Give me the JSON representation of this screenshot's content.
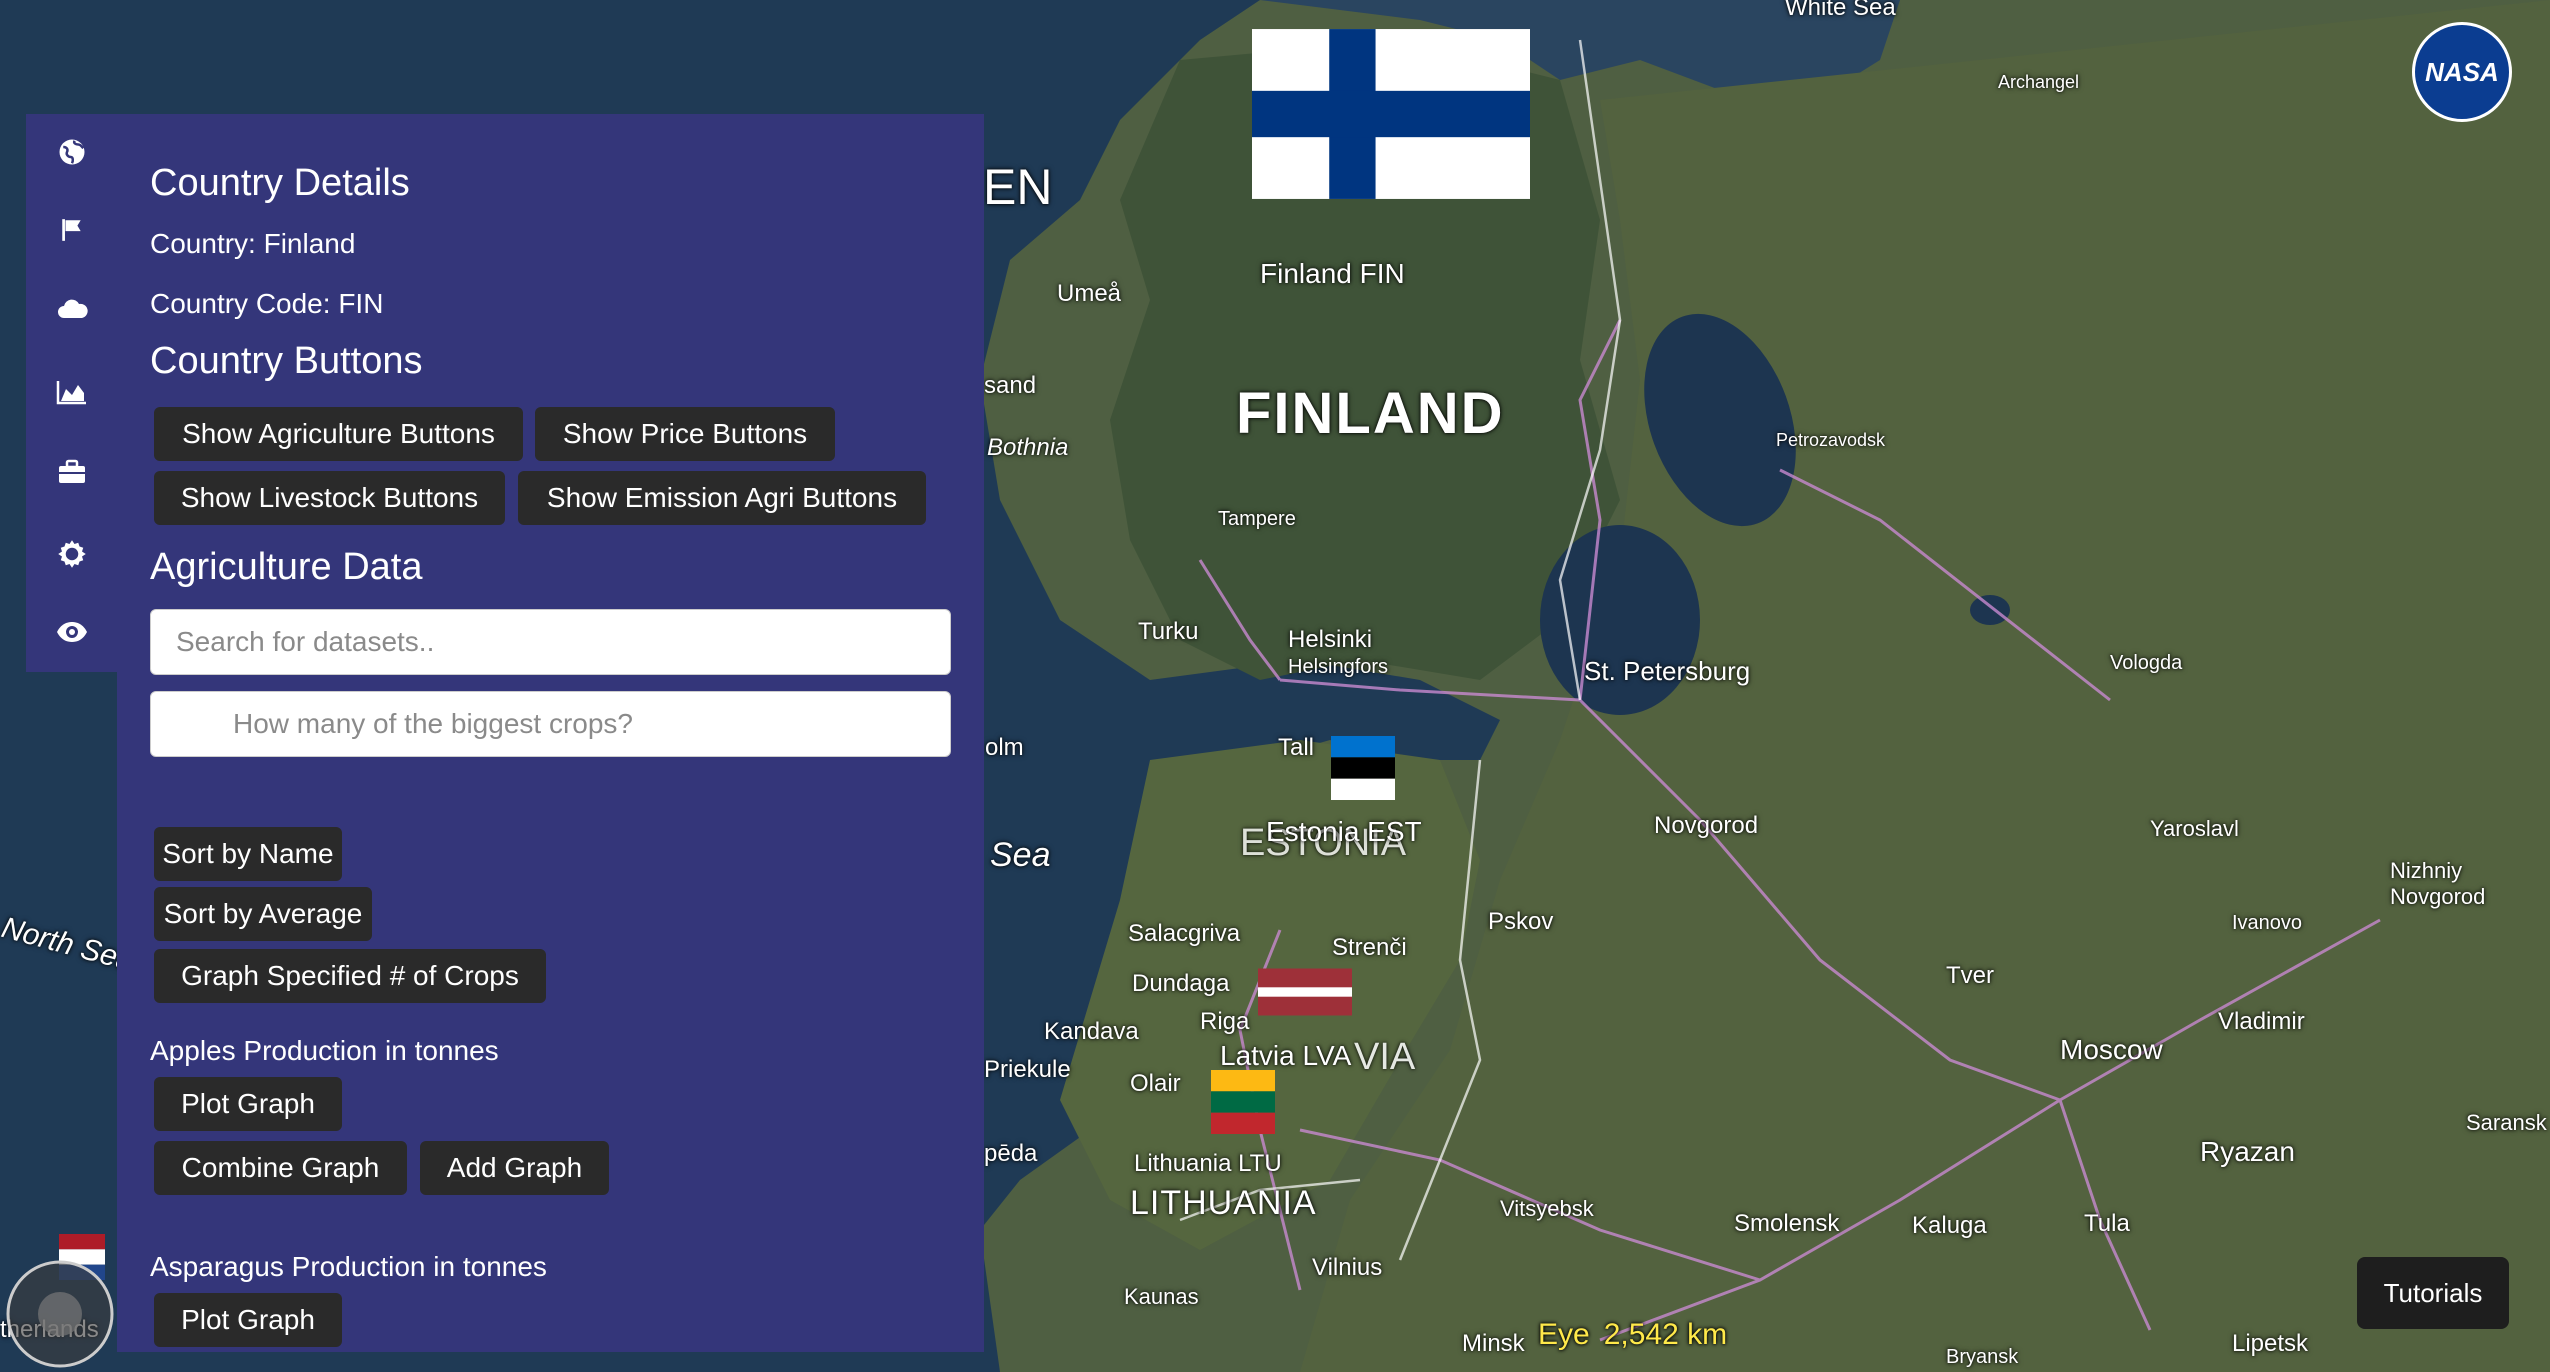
{
  "map": {
    "labels": {
      "finland_big": "FINLAND",
      "finland_flag_label": "Finland FIN",
      "estonia_flag_label": "Estonia EST",
      "latvia_flag_label": "Latvia LVA",
      "lithuania_flag_label": "Lithuania LTU",
      "lithuania_big": "LITHUANIA",
      "estonia_big": "ESTONIA",
      "latvia_big": "VIA",
      "white_sea": "White Sea",
      "north_sea": "North Sea",
      "sea": "Sea",
      "bothnia": "Bothnia",
      "en": "EN",
      "umea": "Umeå",
      "sand": "sand",
      "olm": "olm",
      "tampere": "Tampere",
      "turku": "Turku",
      "helsinki": "Helsinki",
      "helsingfors": "Helsingfors",
      "tallinn": "Tall",
      "st_petersburg": "St. Petersburg",
      "petrozavodsk": "Petrozavodsk",
      "vologda": "Vologda",
      "archangel": "Archangel",
      "novgorod": "Novgorod",
      "yaroslavl": "Yaroslavl",
      "ivanovo": "Ivanovo",
      "nizhniy": "Nizhniy Novgorod",
      "pskov": "Pskov",
      "tver": "Tver",
      "moscow": "Moscow",
      "vladimir": "Vladimir",
      "ryazan": "Ryazan",
      "saransk": "Saransk",
      "tula": "Tula",
      "kaluga": "Kaluga",
      "smolensk": "Smolensk",
      "vitsyebsk": "Vitsyebsk",
      "vilnius": "Vilnius",
      "kaunas": "Kaunas",
      "minsk": "Minsk",
      "salacgriva": "Salacgriva",
      "strenci": "Strenči",
      "dundaga": "Dundaga",
      "riga": "Riga",
      "kandava": "Kandava",
      "priekule": "Priekule",
      "olaine": "Olair",
      "lipetsk": "Lipetsk",
      "bryansk": "Bryansk",
      "peda": "pēda",
      "netherlands": "therlands"
    },
    "eye_label": "Eye",
    "eye_value": "2,542 km",
    "nasa_logo_text": "NASA",
    "tutorials_label": "Tutorials"
  },
  "sidebar": {
    "icons": [
      "globe-icon",
      "flag-icon",
      "cloud-icon",
      "area-chart-icon",
      "briefcase-icon",
      "gear-icon",
      "eye-icon"
    ]
  },
  "panel": {
    "country_details_title": "Country Details",
    "country_line": "Country: Finland",
    "country_code_line": "Country Code: FIN",
    "country_buttons_title": "Country Buttons",
    "buttons": {
      "agriculture": "Show Agriculture Buttons",
      "price": "Show Price Buttons",
      "livestock": "Show Livestock Buttons",
      "emission": "Show Emission Agri Buttons"
    },
    "agriculture_title": "Agriculture Data",
    "search_placeholder": "Search for datasets..",
    "crops_placeholder": "How many of the biggest crops?",
    "sort_name": "Sort by Name",
    "sort_average": "Sort by Average",
    "graph_specified": "Graph Specified # of Crops",
    "datasets": [
      {
        "title": "Apples Production in tonnes",
        "plot": "Plot Graph",
        "combine": "Combine Graph",
        "add": "Add Graph"
      },
      {
        "title": "Asparagus Production in tonnes",
        "plot": "Plot Graph"
      }
    ]
  },
  "colors": {
    "panel_bg": "#34367a",
    "button_bg": "#2a2a2a",
    "finland_blue": "#003580"
  }
}
